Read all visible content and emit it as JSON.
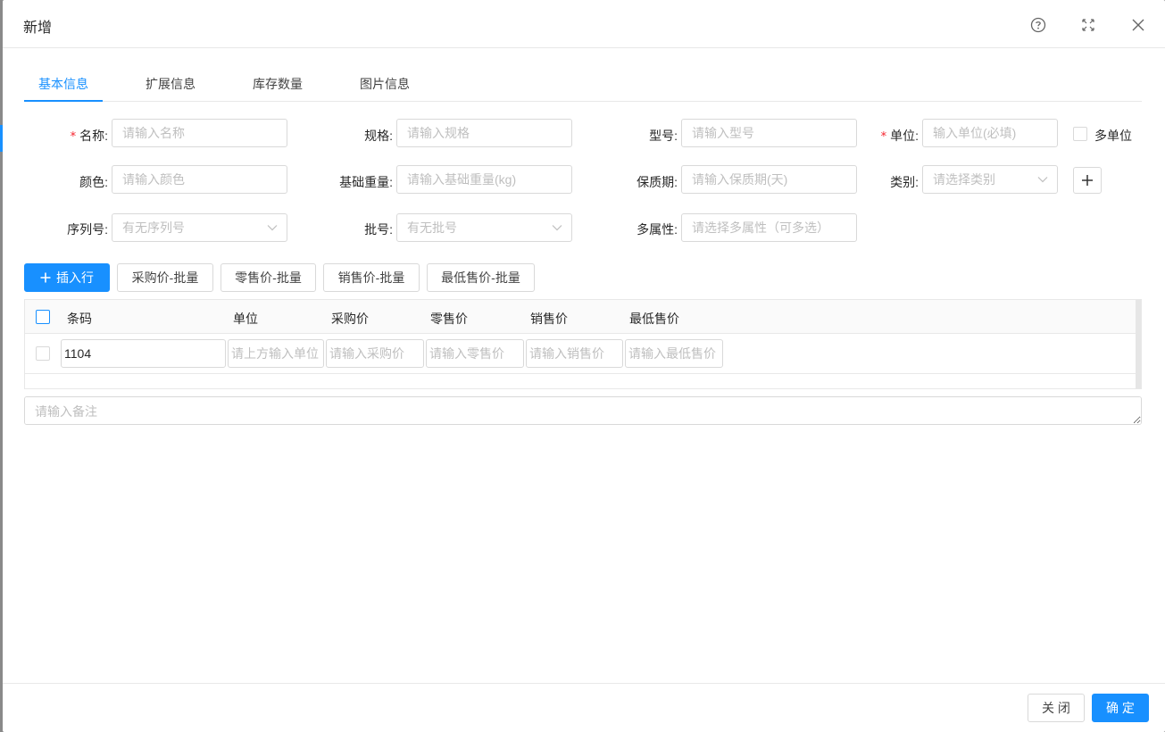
{
  "dialog": {
    "title": "新增"
  },
  "header_icons": {
    "help": "question-circle-icon",
    "fullscreen": "fullscreen-icon",
    "close": "close-icon"
  },
  "tabs": [
    {
      "label": "基本信息",
      "active": true
    },
    {
      "label": "扩展信息",
      "active": false
    },
    {
      "label": "库存数量",
      "active": false
    },
    {
      "label": "图片信息",
      "active": false
    }
  ],
  "form": {
    "name": {
      "label": "名称:",
      "placeholder": "请输入名称",
      "required": true
    },
    "spec": {
      "label": "规格:",
      "placeholder": "请输入规格"
    },
    "model": {
      "label": "型号:",
      "placeholder": "请输入型号"
    },
    "unit": {
      "label": "单位:",
      "placeholder": "输入单位(必填)",
      "required": true
    },
    "multi_unit": {
      "label": "多单位",
      "checked": false
    },
    "color": {
      "label": "颜色:",
      "placeholder": "请输入颜色"
    },
    "weight": {
      "label": "基础重量:",
      "placeholder": "请输入基础重量(kg)"
    },
    "shelf_life": {
      "label": "保质期:",
      "placeholder": "请输入保质期(天)"
    },
    "category": {
      "label": "类别:",
      "placeholder": "请选择类别"
    },
    "serial": {
      "label": "序列号:",
      "placeholder": "有无序列号"
    },
    "batch": {
      "label": "批号:",
      "placeholder": "有无批号"
    },
    "attributes": {
      "label": "多属性:",
      "placeholder": "请选择多属性（可多选）"
    }
  },
  "toolbar": {
    "insert_row": "插入行",
    "purchase_batch": "采购价-批量",
    "retail_batch": "零售价-批量",
    "sale_batch": "销售价-批量",
    "min_sale_batch": "最低售价-批量"
  },
  "table": {
    "columns": [
      "条码",
      "单位",
      "采购价",
      "零售价",
      "销售价",
      "最低售价"
    ],
    "rows": [
      {
        "barcode": "1104",
        "unit_placeholder": "请上方输入单位",
        "purchase_placeholder": "请输入采购价",
        "retail_placeholder": "请输入零售价",
        "sale_placeholder": "请输入销售价",
        "min_sale_placeholder": "请输入最低售价"
      }
    ]
  },
  "remark": {
    "placeholder": "请输入备注"
  },
  "footer": {
    "close_label": "关 闭",
    "ok_label": "确 定"
  },
  "colors": {
    "primary": "#1890ff",
    "required": "#f5222d",
    "border": "#d9d9d9"
  }
}
